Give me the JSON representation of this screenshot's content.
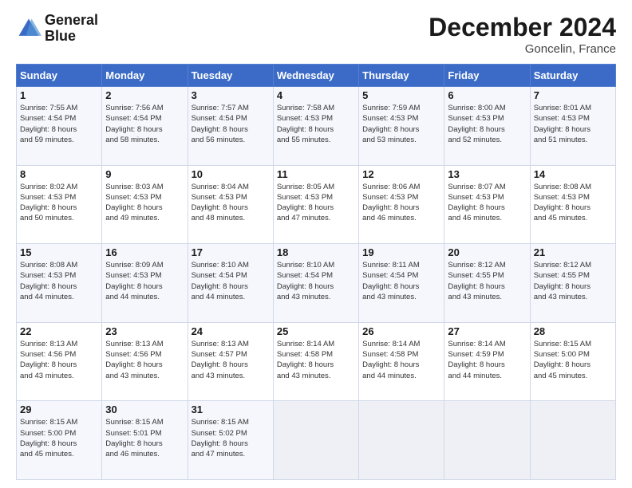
{
  "header": {
    "logo_line1": "General",
    "logo_line2": "Blue",
    "month": "December 2024",
    "location": "Goncelin, France"
  },
  "weekdays": [
    "Sunday",
    "Monday",
    "Tuesday",
    "Wednesday",
    "Thursday",
    "Friday",
    "Saturday"
  ],
  "weeks": [
    [
      {
        "day": "1",
        "sunrise": "7:55 AM",
        "sunset": "4:54 PM",
        "daylight": "8 hours and 59 minutes."
      },
      {
        "day": "2",
        "sunrise": "7:56 AM",
        "sunset": "4:54 PM",
        "daylight": "8 hours and 58 minutes."
      },
      {
        "day": "3",
        "sunrise": "7:57 AM",
        "sunset": "4:54 PM",
        "daylight": "8 hours and 56 minutes."
      },
      {
        "day": "4",
        "sunrise": "7:58 AM",
        "sunset": "4:53 PM",
        "daylight": "8 hours and 55 minutes."
      },
      {
        "day": "5",
        "sunrise": "7:59 AM",
        "sunset": "4:53 PM",
        "daylight": "8 hours and 53 minutes."
      },
      {
        "day": "6",
        "sunrise": "8:00 AM",
        "sunset": "4:53 PM",
        "daylight": "8 hours and 52 minutes."
      },
      {
        "day": "7",
        "sunrise": "8:01 AM",
        "sunset": "4:53 PM",
        "daylight": "8 hours and 51 minutes."
      }
    ],
    [
      {
        "day": "8",
        "sunrise": "8:02 AM",
        "sunset": "4:53 PM",
        "daylight": "8 hours and 50 minutes."
      },
      {
        "day": "9",
        "sunrise": "8:03 AM",
        "sunset": "4:53 PM",
        "daylight": "8 hours and 49 minutes."
      },
      {
        "day": "10",
        "sunrise": "8:04 AM",
        "sunset": "4:53 PM",
        "daylight": "8 hours and 48 minutes."
      },
      {
        "day": "11",
        "sunrise": "8:05 AM",
        "sunset": "4:53 PM",
        "daylight": "8 hours and 47 minutes."
      },
      {
        "day": "12",
        "sunrise": "8:06 AM",
        "sunset": "4:53 PM",
        "daylight": "8 hours and 46 minutes."
      },
      {
        "day": "13",
        "sunrise": "8:07 AM",
        "sunset": "4:53 PM",
        "daylight": "8 hours and 46 minutes."
      },
      {
        "day": "14",
        "sunrise": "8:08 AM",
        "sunset": "4:53 PM",
        "daylight": "8 hours and 45 minutes."
      }
    ],
    [
      {
        "day": "15",
        "sunrise": "8:08 AM",
        "sunset": "4:53 PM",
        "daylight": "8 hours and 44 minutes."
      },
      {
        "day": "16",
        "sunrise": "8:09 AM",
        "sunset": "4:53 PM",
        "daylight": "8 hours and 44 minutes."
      },
      {
        "day": "17",
        "sunrise": "8:10 AM",
        "sunset": "4:54 PM",
        "daylight": "8 hours and 44 minutes."
      },
      {
        "day": "18",
        "sunrise": "8:10 AM",
        "sunset": "4:54 PM",
        "daylight": "8 hours and 43 minutes."
      },
      {
        "day": "19",
        "sunrise": "8:11 AM",
        "sunset": "4:54 PM",
        "daylight": "8 hours and 43 minutes."
      },
      {
        "day": "20",
        "sunrise": "8:12 AM",
        "sunset": "4:55 PM",
        "daylight": "8 hours and 43 minutes."
      },
      {
        "day": "21",
        "sunrise": "8:12 AM",
        "sunset": "4:55 PM",
        "daylight": "8 hours and 43 minutes."
      }
    ],
    [
      {
        "day": "22",
        "sunrise": "8:13 AM",
        "sunset": "4:56 PM",
        "daylight": "8 hours and 43 minutes."
      },
      {
        "day": "23",
        "sunrise": "8:13 AM",
        "sunset": "4:56 PM",
        "daylight": "8 hours and 43 minutes."
      },
      {
        "day": "24",
        "sunrise": "8:13 AM",
        "sunset": "4:57 PM",
        "daylight": "8 hours and 43 minutes."
      },
      {
        "day": "25",
        "sunrise": "8:14 AM",
        "sunset": "4:58 PM",
        "daylight": "8 hours and 43 minutes."
      },
      {
        "day": "26",
        "sunrise": "8:14 AM",
        "sunset": "4:58 PM",
        "daylight": "8 hours and 44 minutes."
      },
      {
        "day": "27",
        "sunrise": "8:14 AM",
        "sunset": "4:59 PM",
        "daylight": "8 hours and 44 minutes."
      },
      {
        "day": "28",
        "sunrise": "8:15 AM",
        "sunset": "5:00 PM",
        "daylight": "8 hours and 45 minutes."
      }
    ],
    [
      {
        "day": "29",
        "sunrise": "8:15 AM",
        "sunset": "5:00 PM",
        "daylight": "8 hours and 45 minutes."
      },
      {
        "day": "30",
        "sunrise": "8:15 AM",
        "sunset": "5:01 PM",
        "daylight": "8 hours and 46 minutes."
      },
      {
        "day": "31",
        "sunrise": "8:15 AM",
        "sunset": "5:02 PM",
        "daylight": "8 hours and 47 minutes."
      },
      null,
      null,
      null,
      null
    ]
  ],
  "labels": {
    "sunrise_prefix": "Sunrise: ",
    "sunset_prefix": "Sunset: ",
    "daylight_prefix": "Daylight: "
  }
}
